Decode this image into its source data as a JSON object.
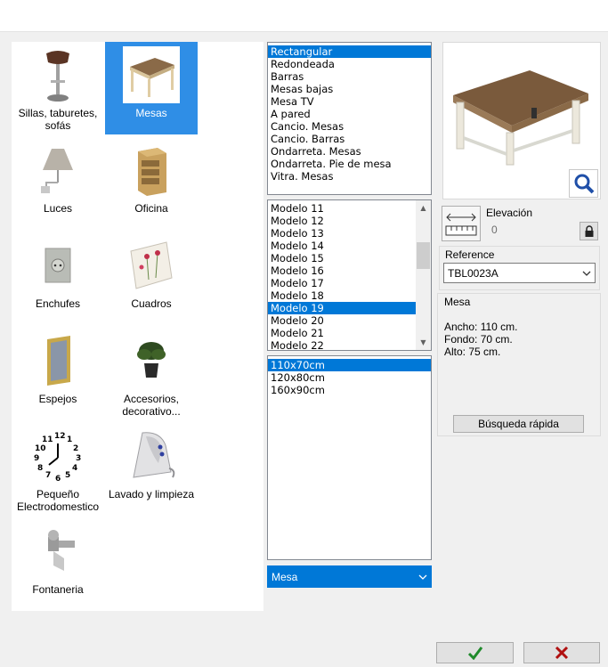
{
  "categories": [
    {
      "label": "Sillas, taburetes, sofás",
      "icon": "bar-stool-icon"
    },
    {
      "label": "Mesas",
      "icon": "table-icon",
      "selected": true
    },
    {
      "label": "Luces",
      "icon": "lamp-icon"
    },
    {
      "label": "Oficina",
      "icon": "cabinet-icon"
    },
    {
      "label": "Enchufes",
      "icon": "socket-icon"
    },
    {
      "label": "Cuadros",
      "icon": "picture-icon"
    },
    {
      "label": "Espejos",
      "icon": "mirror-icon"
    },
    {
      "label": "Accesorios, decorativo...",
      "icon": "plant-icon"
    },
    {
      "label": "Pequeño Electrodomestico",
      "icon": "clock-icon"
    },
    {
      "label": "Lavado y limpieza",
      "icon": "iron-icon"
    },
    {
      "label": "Fontaneria",
      "icon": "faucet-icon"
    }
  ],
  "types": [
    "Rectangular",
    "Redondeada",
    "Barras",
    "Mesas bajas",
    "Mesa TV",
    "A pared",
    "Cancio. Mesas",
    "Cancio. Barras",
    "Ondarreta. Mesas",
    "Ondarreta. Pie de mesa",
    "Vitra. Mesas"
  ],
  "types_selected": "Rectangular",
  "models": [
    "Modelo 11",
    "Modelo 12",
    "Modelo 13",
    "Modelo 14",
    "Modelo 15",
    "Modelo 16",
    "Modelo 17",
    "Modelo 18",
    "Modelo 19",
    "Modelo 20",
    "Modelo 21",
    "Modelo 22"
  ],
  "models_selected": "Modelo 19",
  "sizes": [
    "110x70cm",
    "120x80cm",
    "160x90cm"
  ],
  "sizes_selected": "110x70cm",
  "bottom_combo": "Mesa",
  "elevation": {
    "label": "Elevación",
    "value": "0"
  },
  "reference": {
    "label": "Reference",
    "value": "TBL0023A"
  },
  "info": {
    "name": "Mesa",
    "ancho": "Ancho: 110 cm.",
    "fondo": "Fondo: 70 cm.",
    "alto": "Alto: 75 cm."
  },
  "quick_search": "Búsqueda rápida",
  "colors": {
    "selection": "#0078d7",
    "category_selected": "#2f8ee6",
    "ok": "#1f8a2b",
    "cancel": "#b01010"
  }
}
